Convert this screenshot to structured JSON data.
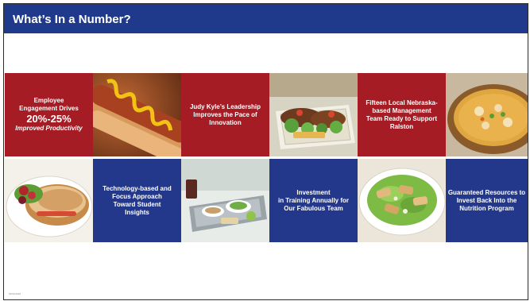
{
  "slide": {
    "title": "What’s In a Number?",
    "footer": "02/01/2018"
  },
  "tiles": {
    "engagement": {
      "line1": "Employee",
      "line2": "Engagement Drives",
      "stat": "20%-25%",
      "caption": "Improved Productivity"
    },
    "leadership": {
      "line1": "Judy Kyle’s Leadership",
      "line2": "Improves the Pace of",
      "line3": "Innovation"
    },
    "management": {
      "line1": "Fifteen Local Nebraska-",
      "line2": "based Management",
      "line3": "Team Ready to Support",
      "line4": "Ralston"
    },
    "technology": {
      "line1": "Technology-based and",
      "line2": "Focus Approach",
      "line3": "Toward Student",
      "line4": "Insights"
    },
    "training": {
      "line1": "Investment",
      "line2": "in Training Annually for",
      "line3": "Our Fabulous Team"
    },
    "resources": {
      "line1": "Guaranteed Resources to",
      "line2": "Invest Back Into the",
      "line3": "Nutrition Program"
    }
  },
  "photos": {
    "hotdog": "hotdog-photo",
    "nachos": "taco-salad-photo",
    "soup": "soup-photo",
    "sandwich": "sandwich-photo",
    "cafeteria": "cafeteria-tray-photo",
    "salad": "chicken-salad-photo"
  },
  "colors": {
    "title_bar": "#1f3a8a",
    "red_tile": "#a51c24",
    "blue_tile": "#23388a"
  }
}
